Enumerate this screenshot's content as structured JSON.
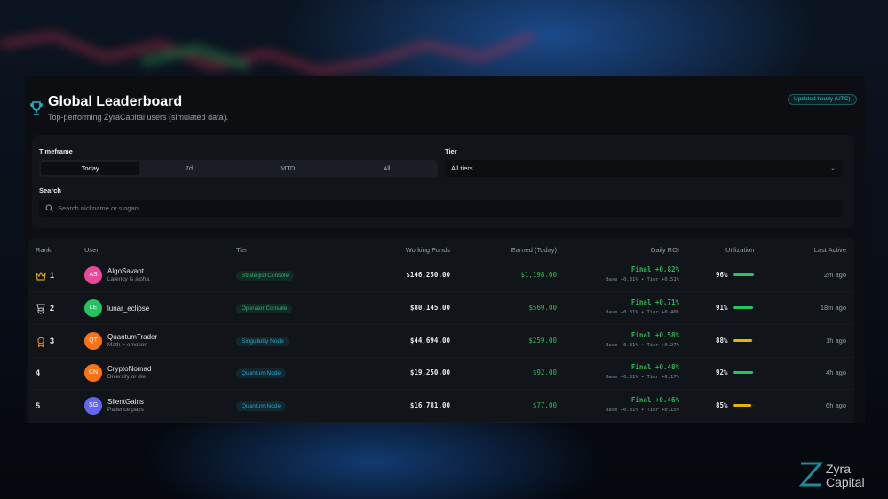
{
  "header": {
    "title": "Global Leaderboard",
    "subtitle": "Top-performing ZyraCapital users (simulated data).",
    "badge": "Updated hourly (UTC)"
  },
  "filters": {
    "timeframe_label": "Timeframe",
    "timeframes": [
      "Today",
      "7d",
      "MTD",
      "All"
    ],
    "active_timeframe": "Today",
    "tier_label": "Tier",
    "tier_value": "All tiers",
    "search_label": "Search",
    "search_placeholder": "Search nickname or slogan..."
  },
  "table": {
    "columns": [
      "Rank",
      "User",
      "Tier",
      "Working Funds",
      "Earned (Today)",
      "Daily ROI",
      "Utilization",
      "Last Active"
    ],
    "rows": [
      {
        "rank": "1",
        "medal": "crown",
        "initials": "AS",
        "avatar_color": "#ec4899",
        "name": "AlgoSavant",
        "slogan": "Latency is alpha.",
        "tier": "Strategist Console",
        "tier_color": "#2bb673",
        "funds": "$146,250.00",
        "earned": "$1,198.00",
        "roi_final": "Final +0.82%",
        "roi_breakdown": "Base +0.31% • Tier +0.51%",
        "utilization": "96%",
        "util_value": 96,
        "util_color": "#22c55e",
        "last_active": "2m ago"
      },
      {
        "rank": "2",
        "medal": "silver",
        "initials": "LE",
        "avatar_color": "#22c55e",
        "name": "lunar_eclipse",
        "slogan": "",
        "tier": "Operator Console",
        "tier_color": "#2bb673",
        "funds": "$80,145.00",
        "earned": "$569.00",
        "roi_final": "Final +0.71%",
        "roi_breakdown": "Base +0.31% • Tier +0.40%",
        "utilization": "91%",
        "util_value": 91,
        "util_color": "#22c55e",
        "last_active": "18m ago"
      },
      {
        "rank": "3",
        "medal": "bronze",
        "initials": "QT",
        "avatar_color": "#f97316",
        "name": "QuantumTrader",
        "slogan": "Math > emotion",
        "tier": "Singularity Node",
        "tier_color": "#22a7c4",
        "funds": "$44,694.00",
        "earned": "$259.00",
        "roi_final": "Final +0.58%",
        "roi_breakdown": "Base +0.31% • Tier +0.27%",
        "utilization": "88%",
        "util_value": 88,
        "util_color": "#eab308",
        "last_active": "1h ago"
      },
      {
        "rank": "4",
        "medal": "",
        "initials": "CN",
        "avatar_color": "#f97316",
        "name": "CryptoNomad",
        "slogan": "Diversify or die",
        "tier": "Quantum Node",
        "tier_color": "#22a7c4",
        "funds": "$19,250.00",
        "earned": "$92.00",
        "roi_final": "Final +0.48%",
        "roi_breakdown": "Base +0.31% • Tier +0.17%",
        "utilization": "92%",
        "util_value": 92,
        "util_color": "#22c55e",
        "last_active": "4h ago"
      },
      {
        "rank": "5",
        "medal": "",
        "initials": "SG",
        "avatar_color": "#6366f1",
        "name": "SilentGains",
        "slogan": "Patience pays",
        "tier": "Quantum Node",
        "tier_color": "#22a7c4",
        "funds": "$16,781.00",
        "earned": "$77.00",
        "roi_final": "Final +0.46%",
        "roi_breakdown": "Base +0.31% • Tier +0.15%",
        "utilization": "85%",
        "util_value": 85,
        "util_color": "#eab308",
        "last_active": "6h ago"
      }
    ]
  },
  "brand": {
    "line1": "Zyra",
    "line2": "Capital"
  }
}
